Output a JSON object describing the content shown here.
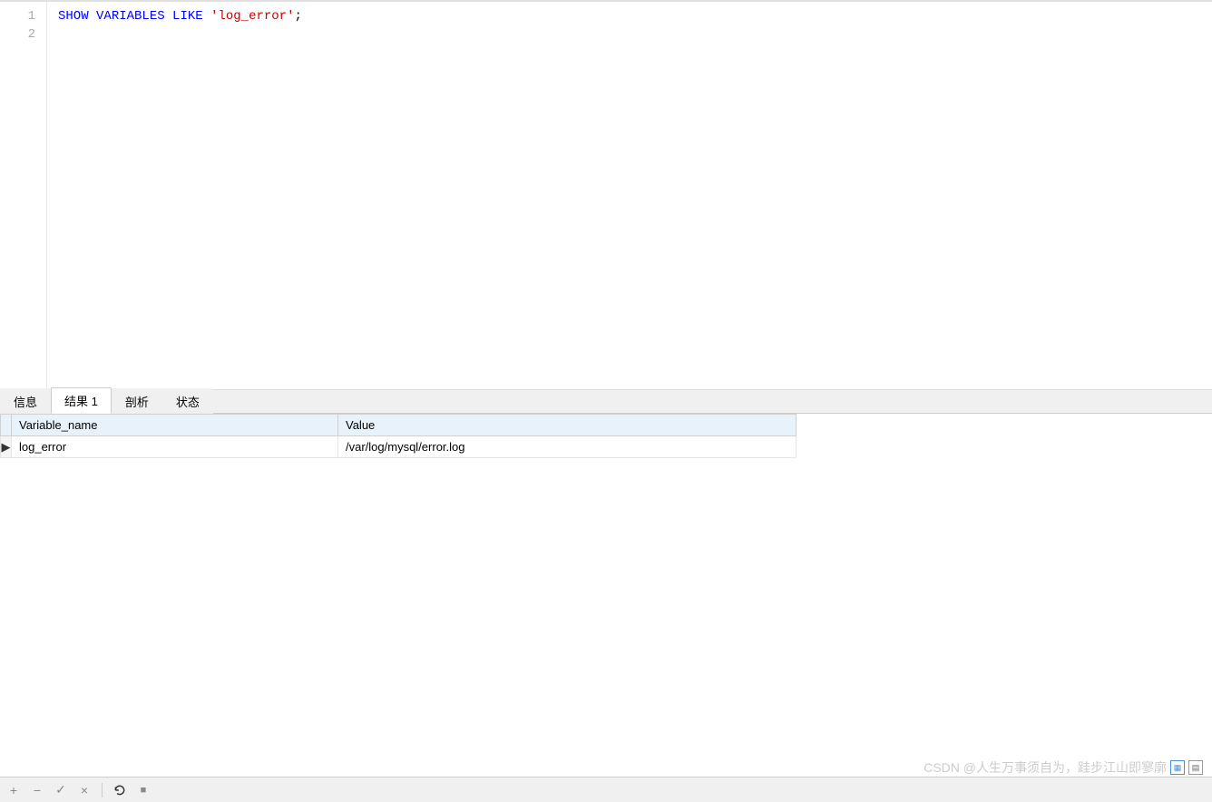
{
  "editor": {
    "lines": [
      "1",
      "2"
    ],
    "sql": {
      "kw1": "SHOW",
      "kw2": "VARIABLES",
      "kw3": "LIKE",
      "str": "'log_error'",
      "term": ";"
    }
  },
  "tabs": {
    "info": "信息",
    "result1": "结果 1",
    "profile": "剖析",
    "status": "状态"
  },
  "table": {
    "headers": {
      "col1": "Variable_name",
      "col2": "Value"
    },
    "rows": [
      {
        "indicator": "▶",
        "variable_name": "log_error",
        "value": "/var/log/mysql/error.log"
      }
    ]
  },
  "toolbar": {
    "plus": "+",
    "minus": "−",
    "check": "✓",
    "close": "×",
    "refresh": "↻",
    "stop": "■"
  },
  "watermark": {
    "text": "CSDN @人生万事须自为，跬步江山即寥廓"
  }
}
